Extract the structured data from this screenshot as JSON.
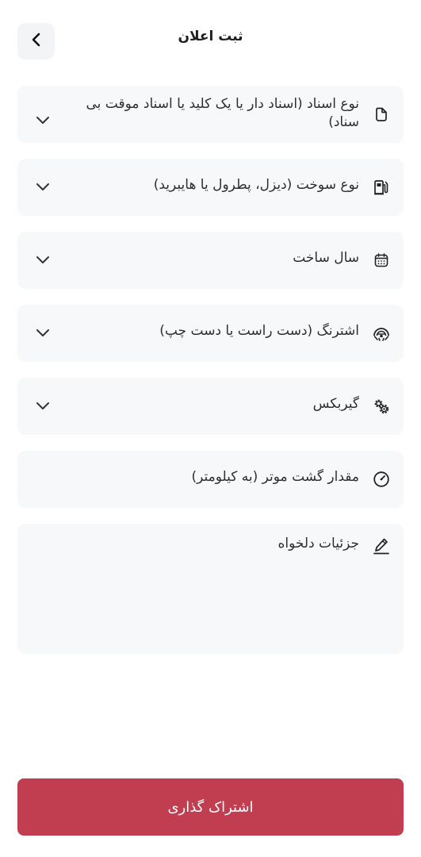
{
  "header": {
    "title": "ثبت اعلان",
    "back_icon": "chevron-left-icon"
  },
  "fields": [
    {
      "label": "نوع اسناد (اسناد دار یا یک کلید یا اسناد موقت بی سناد)",
      "icon": "document-icon",
      "type": "select"
    },
    {
      "label": "نوع سوخت (دیزل، پطرول یا هایبرید)",
      "icon": "fuel-pump-icon",
      "type": "select"
    },
    {
      "label": "سال ساخت",
      "icon": "calendar-icon",
      "type": "select"
    },
    {
      "label": "اشترنگ (دست راست یا دست چپ)",
      "icon": "steering-wheel-icon",
      "type": "select"
    },
    {
      "label": "گیربکس",
      "icon": "gears-icon",
      "type": "select"
    },
    {
      "label": "مقدار گشت موتر (به کیلومتر)",
      "icon": "speedometer-icon",
      "type": "input"
    },
    {
      "label": "جزئیات دلخواه",
      "icon": "pencil-icon",
      "type": "textarea"
    }
  ],
  "submit": {
    "label": "اشتراک گذاری",
    "color": "#c13e50"
  }
}
